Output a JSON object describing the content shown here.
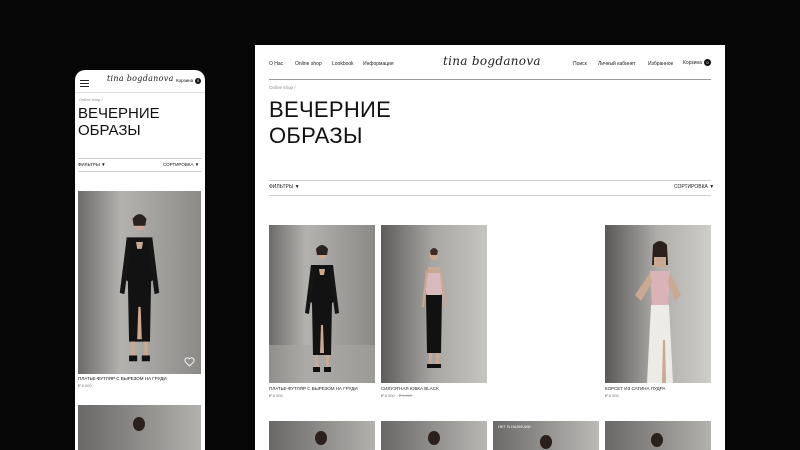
{
  "desktop": {
    "nav_left": [
      "О Нас",
      "Online shop",
      "Lookbook",
      "Информация"
    ],
    "logo": "tina bogdanova",
    "nav_right": [
      "Поиск",
      "Личный кабинет",
      "Избранное"
    ],
    "cart_label": "Корзина",
    "cart_count": "0",
    "breadcrumb": "Online shop  /",
    "title_line1": "ВЕЧЕРНИЕ",
    "title_line2": "ОБРАЗЫ",
    "filters": "ФИЛЬТРЫ",
    "sort": "СОРТИРОВКА",
    "products": [
      {
        "name": "ПЛАТЬЕ-ФУТЛЯР С ВЫРЕЗОМ НА ГРУДИ",
        "price": "₽  8 000",
        "old_price": ""
      },
      {
        "name": "СИЛУЭТНАЯ ЮБКА BLACK",
        "price": "₽  8 000",
        "old_price": "₽ 8 000"
      },
      {
        "name": "КОРСЕТ ИЗ САТИНА ПУДРА",
        "price": "₽  8 000",
        "old_price": ""
      }
    ],
    "out_of_stock_label": "НЕТ В НАЛИЧИИ"
  },
  "mobile": {
    "logo": "tina bogdanova",
    "cart_label": "Корзина",
    "cart_count": "0",
    "breadcrumb": "Online shop  /",
    "title_line1": "ВЕЧЕРНИЕ",
    "title_line2": "ОБРАЗЫ",
    "filters": "ФИЛЬТРЫ",
    "sort": "СОРТИРОВКА",
    "product": {
      "name": "ПЛАТЬЕ-ФУТЛЯР С ВЫРЕЗОМ НА ГРУДИ",
      "price": "₽  8 000"
    }
  },
  "icons": {
    "menu": "hamburger-icon",
    "favorite": "heart-icon",
    "dropdown": "triangle-down-icon"
  },
  "colors": {
    "background": "#060606",
    "panel": "#ffffff",
    "text": "#111111",
    "muted": "#8c8c8c"
  }
}
